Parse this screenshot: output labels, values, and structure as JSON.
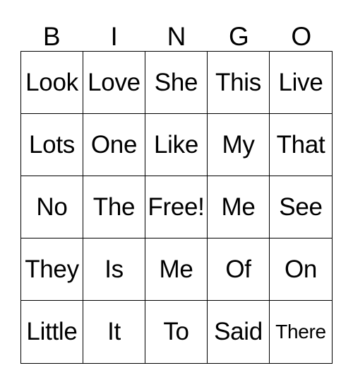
{
  "header": [
    "B",
    "I",
    "N",
    "G",
    "O"
  ],
  "cells": [
    "Look",
    "Love",
    "She",
    "This",
    "Live",
    "Lots",
    "One",
    "Like",
    "My",
    "That",
    "No",
    "The",
    "Free!",
    "Me",
    "See",
    "They",
    "Is",
    "Me",
    "Of",
    "On",
    "Little",
    "It",
    "To",
    "Said",
    "There"
  ]
}
